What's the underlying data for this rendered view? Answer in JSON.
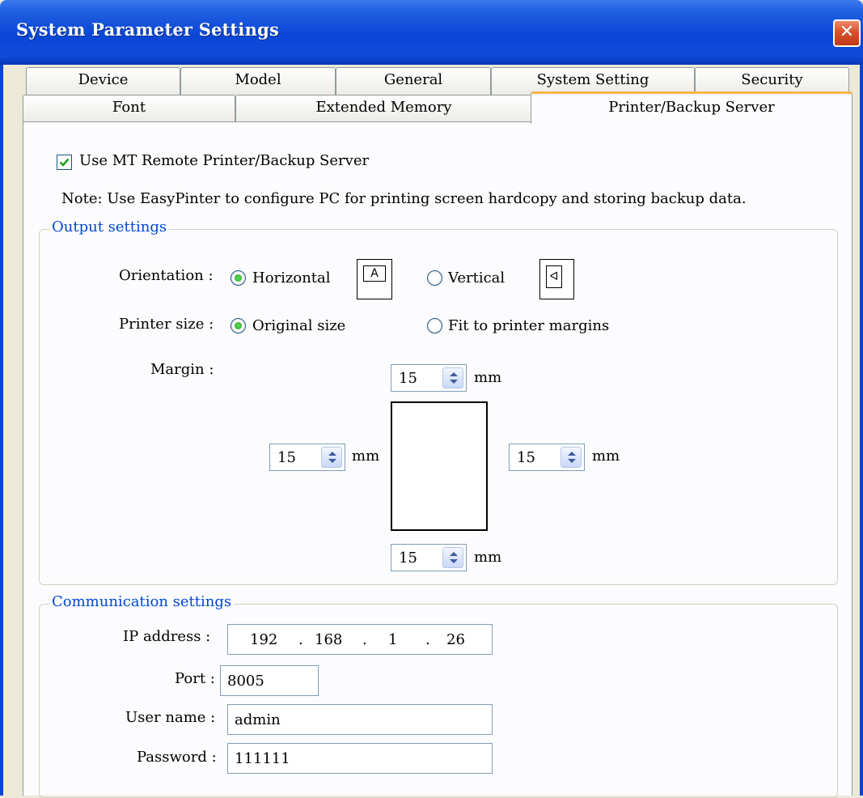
{
  "window": {
    "title": "System Parameter Settings",
    "close_glyph": "✕"
  },
  "tabs": {
    "row1": [
      "Device",
      "Model",
      "General",
      "System Setting",
      "Security"
    ],
    "row2": [
      "Font",
      "Extended Memory",
      "Printer/Backup Server"
    ],
    "active": "Printer/Backup Server"
  },
  "use_mt": {
    "checked": true,
    "label": "Use MT Remote Printer/Backup Server"
  },
  "note": "Note: Use EasyPinter to configure PC for printing screen hardcopy and storing backup data.",
  "output_settings": {
    "legend": "Output settings",
    "orientation_label": "Orientation :",
    "orientation_horizontal": "Horizontal",
    "orientation_vertical": "Vertical",
    "orientation_selected": "Horizontal",
    "horizontal_icon_glyph": "A",
    "vertical_icon_glyph": "ᐊ",
    "printer_size_label": "Printer size :",
    "printer_size_original": "Original size",
    "printer_size_fit": "Fit to printer margins",
    "printer_size_selected": "Original size",
    "margin_label": "Margin :",
    "margin_top": "15",
    "margin_left": "15",
    "margin_right": "15",
    "margin_bottom": "15",
    "unit": "mm"
  },
  "communication_settings": {
    "legend": "Communication settings",
    "ip_label": "IP address :",
    "ip": [
      "192",
      "168",
      "1",
      "26"
    ],
    "ip_dot": ".",
    "port_label": "Port :",
    "port": "8005",
    "username_label": "User name :",
    "username": "admin",
    "password_label": "Password :",
    "password": "111111"
  },
  "icons": {
    "checkbox_check": "check-icon",
    "spinner": "spin-updown-icon",
    "close": "close-icon"
  },
  "colors": {
    "titlebar": "#0a46d6",
    "legend_text": "#0046d5",
    "active_tab_accent": "#f7b44a",
    "close_button": "#d8512d",
    "radio_dot": "#21a121"
  }
}
